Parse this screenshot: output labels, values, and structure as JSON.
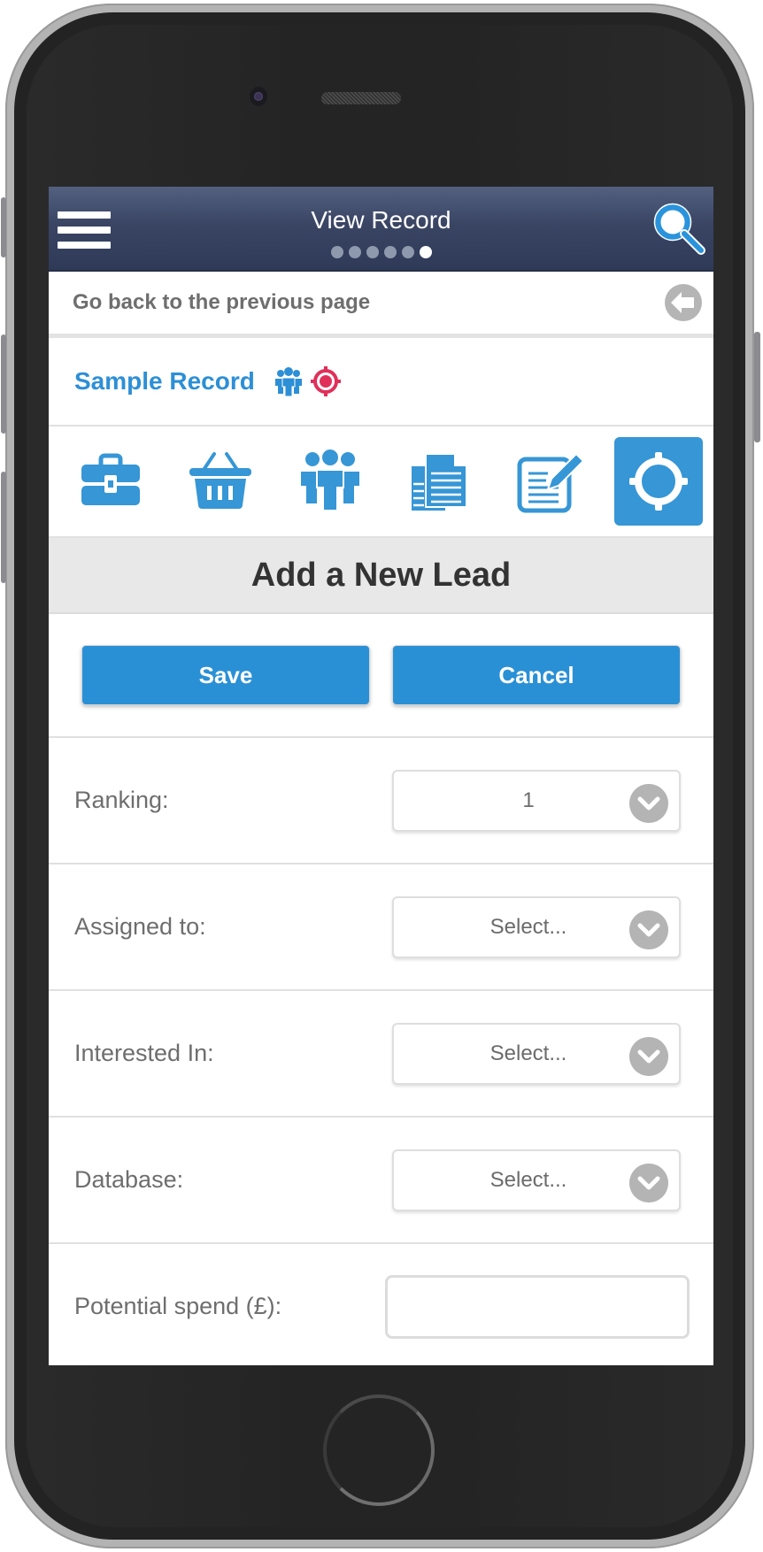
{
  "header": {
    "title": "View Record",
    "page_dots": 6,
    "active_dot": 6,
    "menu_icon": "hamburger-menu-icon",
    "search_icon": "search-icon"
  },
  "back_row": {
    "label": "Go back to the previous page",
    "icon": "back-arrow-icon"
  },
  "record": {
    "name": "Sample Record",
    "icons": [
      "people-icon",
      "target-icon"
    ],
    "accent_color": "#2d8fd6",
    "target_color": "#e0305a"
  },
  "toolbar": {
    "icons": [
      {
        "name": "briefcase-icon",
        "active": false
      },
      {
        "name": "basket-icon",
        "active": false
      },
      {
        "name": "people-icon",
        "active": false
      },
      {
        "name": "documents-icon",
        "active": false
      },
      {
        "name": "edit-note-icon",
        "active": false
      },
      {
        "name": "target-icon",
        "active": true
      }
    ],
    "icon_color": "#3696d6"
  },
  "section": {
    "title": "Add a New Lead"
  },
  "actions": {
    "save_label": "Save",
    "cancel_label": "Cancel",
    "button_color": "#2a90d6"
  },
  "form": {
    "fields": [
      {
        "label": "Ranking:",
        "type": "select",
        "value": "1"
      },
      {
        "label": "Assigned to:",
        "type": "select",
        "value": "Select..."
      },
      {
        "label": "Interested In:",
        "type": "select",
        "value": "Select..."
      },
      {
        "label": "Database:",
        "type": "select",
        "value": "Select..."
      },
      {
        "label": "Potential spend (£):",
        "type": "text",
        "value": ""
      }
    ]
  }
}
